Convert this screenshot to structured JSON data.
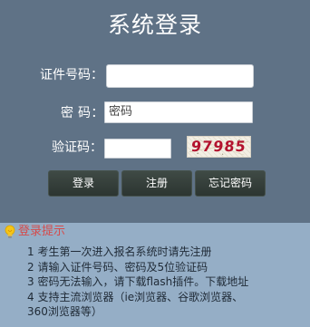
{
  "login": {
    "title": "系统登录",
    "id_label": "证件号码：",
    "id_value": "",
    "password_label": "密 码：",
    "password_placeholder": "密码",
    "captcha_label": "验证码：",
    "captcha_value": "",
    "captcha_text": "97985",
    "buttons": {
      "login": "登录",
      "register": "注册",
      "forgot": "忘记密码"
    }
  },
  "tips": {
    "icon": "lightbulb-icon",
    "title": "登录提示",
    "items": [
      "1 考生第一次进入报名系统时请先注册",
      "2 请输入证件号码、密码及5位验证码",
      "3 密码无法输入，请下载flash插件。下载地址",
      "4 支持主流浏览器（ie浏览器、谷歌浏览器、",
      "360浏览器等）"
    ]
  },
  "colors": {
    "panel_bg": "#5f7286",
    "tips_bg": "#95aec6",
    "tips_title": "#d54b4b",
    "captcha_text": "#b3122e"
  }
}
